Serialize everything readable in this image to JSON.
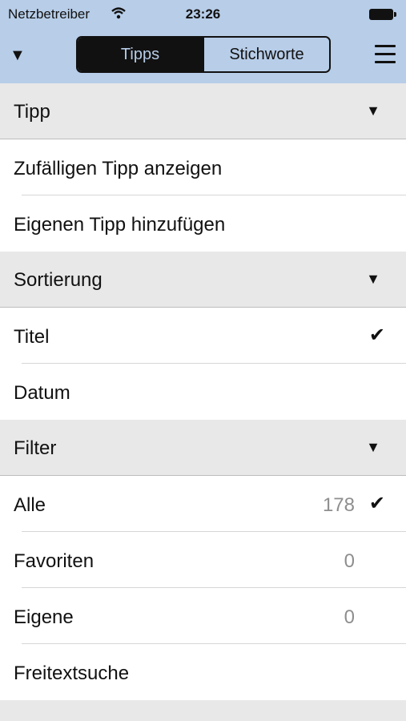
{
  "status": {
    "carrier": "Netzbetreiber",
    "time": "23:26"
  },
  "nav": {
    "left_arrow": "▼",
    "tabs": [
      {
        "label": "Tipps",
        "selected": true
      },
      {
        "label": "Stichworte",
        "selected": false
      }
    ]
  },
  "sections": {
    "tipp": {
      "label": "Tipp",
      "items": [
        {
          "label": "Zufälligen Tipp anzeigen"
        },
        {
          "label": "Eigenen Tipp hinzufügen"
        }
      ]
    },
    "sortierung": {
      "label": "Sortierung",
      "items": [
        {
          "label": "Titel",
          "checked": true,
          "check": "✔"
        },
        {
          "label": "Datum"
        }
      ]
    },
    "filter": {
      "label": "Filter",
      "items": [
        {
          "label": "Alle",
          "count": "178",
          "checked": true,
          "check": "✔"
        },
        {
          "label": "Favoriten",
          "count": "0"
        },
        {
          "label": "Eigene",
          "count": "0"
        },
        {
          "label": "Freitextsuche"
        }
      ]
    }
  },
  "triangle": "▼",
  "colors": {
    "nav_bg": "#b7cde8",
    "section_bg": "#e8e8e8"
  },
  "icons": {
    "wifi": "wifi-icon",
    "battery": "battery-icon",
    "menu": "menu-icon",
    "expand": "expand-triangle-icon",
    "check": "checkmark-icon"
  }
}
